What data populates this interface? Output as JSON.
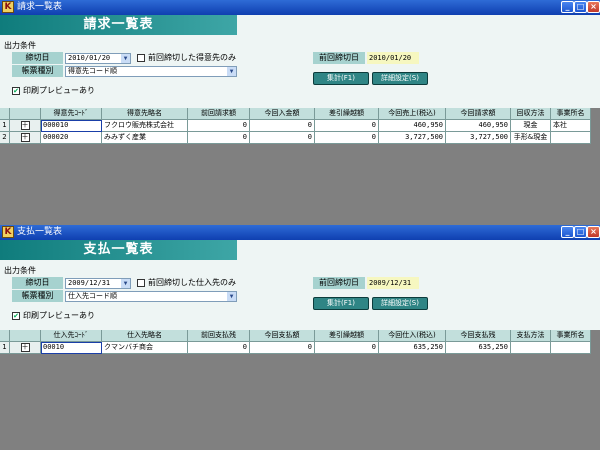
{
  "colors": {
    "banner": "#1f8c8c",
    "label_bg": "#a6d2cf",
    "value_bg": "#f6f7c0",
    "grid_bg": "#808080",
    "titlebar": "#1f55c8",
    "button_bg": "#2f8585"
  },
  "windows": [
    {
      "title": "請求一覧表",
      "banner": "請求一覧表",
      "section": "出力条件",
      "cutoff_label": "締切日",
      "cutoff_value": "2010/01/20",
      "checkbox_label": "前回締切した得意先のみ",
      "type_label": "帳票種別",
      "type_value": "得意先コード順",
      "prev_label": "前回締切日",
      "prev_value": "2010/01/20",
      "btn_calc": "集計(F1)",
      "btn_detail": "詳細設定(S)",
      "preview_label": "印刷プレビューあり",
      "preview_checked": "✔",
      "headers": [
        "",
        "",
        "得意先ｺｰﾄﾞ",
        "得意先略名",
        "前回請求額",
        "今回入金額",
        "差引繰越額",
        "今回売上(税込)",
        "今回請求額",
        "回収方法",
        "事業所名"
      ],
      "rows": [
        [
          "1",
          "＋",
          "000010",
          "フクロウ販売株式会社",
          "0",
          "0",
          "0",
          "460,950",
          "460,950",
          "現金",
          "本社"
        ],
        [
          "2",
          "＋",
          "000020",
          "みみずく産業",
          "0",
          "0",
          "0",
          "3,727,500",
          "3,727,500",
          "手形&現金",
          ""
        ]
      ]
    },
    {
      "title": "支払一覧表",
      "banner": "支払一覧表",
      "section": "出力条件",
      "cutoff_label": "締切日",
      "cutoff_value": "2009/12/31",
      "checkbox_label": "前回締切した仕入先のみ",
      "type_label": "帳票種別",
      "type_value": "仕入先コード順",
      "prev_label": "前回締切日",
      "prev_value": "2009/12/31",
      "btn_calc": "集計(F1)",
      "btn_detail": "詳細設定(S)",
      "preview_label": "印刷プレビューあり",
      "preview_checked": "✔",
      "headers": [
        "",
        "",
        "仕入先ｺｰﾄﾞ",
        "仕入先略名",
        "前回支払残",
        "今回支払額",
        "差引繰越額",
        "今回仕入(税込)",
        "今回支払残",
        "支払方法",
        "事業所名"
      ],
      "rows": [
        [
          "1",
          "＋",
          "00010",
          "クマンバチ商会",
          "0",
          "0",
          "0",
          "635,250",
          "635,250",
          "",
          ""
        ]
      ]
    }
  ]
}
